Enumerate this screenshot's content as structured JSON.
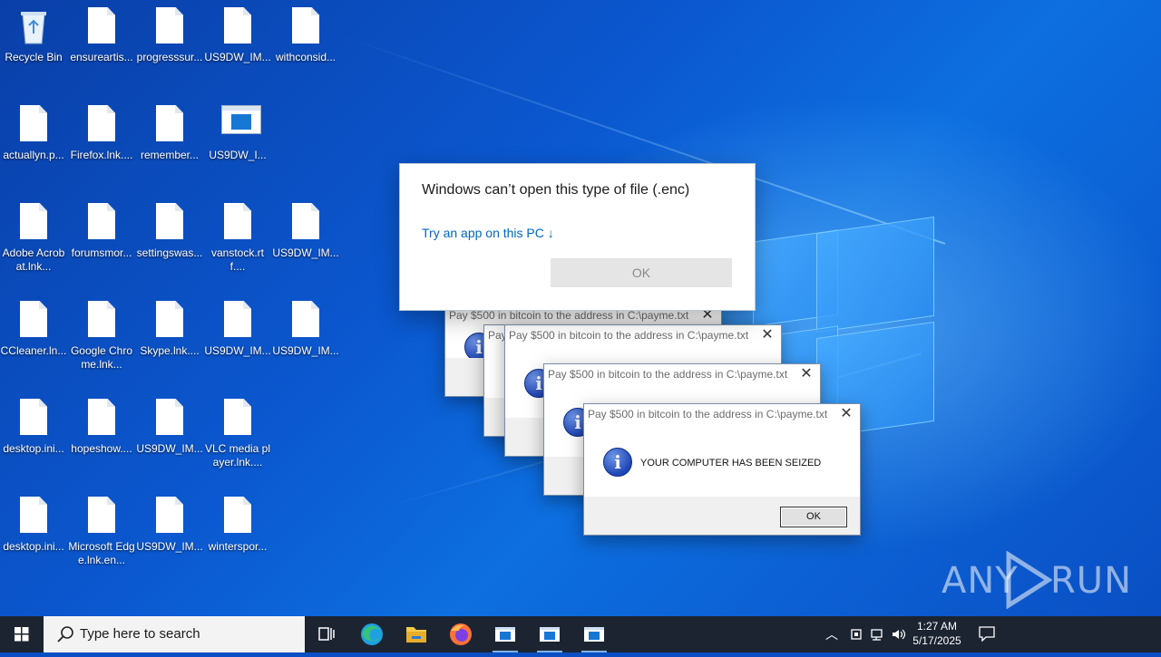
{
  "desktop": {
    "icons": [
      {
        "label": "Recycle Bin",
        "kind": "recycle-bin"
      },
      {
        "label": "ensureartis...",
        "kind": "file"
      },
      {
        "label": "progresssur...",
        "kind": "file"
      },
      {
        "label": "US9DW_IM...",
        "kind": "file"
      },
      {
        "label": "withconsid...",
        "kind": "file"
      },
      {
        "label": "actuallyn.p...",
        "kind": "file"
      },
      {
        "label": "Firefox.lnk....",
        "kind": "file"
      },
      {
        "label": "remember...",
        "kind": "file"
      },
      {
        "label": "US9DW_I...",
        "kind": "app-window"
      },
      {
        "label": "Adobe Acrobat.lnk...",
        "kind": "file"
      },
      {
        "label": "forumsmor...",
        "kind": "file"
      },
      {
        "label": "settingswas...",
        "kind": "file"
      },
      {
        "label": "vanstock.rtf....",
        "kind": "file"
      },
      {
        "label": "US9DW_IM...",
        "kind": "file"
      },
      {
        "label": "CCleaner.ln...",
        "kind": "file"
      },
      {
        "label": "Google Chrome.lnk...",
        "kind": "file"
      },
      {
        "label": "Skype.lnk....",
        "kind": "file"
      },
      {
        "label": "US9DW_IM...",
        "kind": "file"
      },
      {
        "label": "US9DW_IM...",
        "kind": "file"
      },
      {
        "label": "desktop.ini...",
        "kind": "file"
      },
      {
        "label": "hopeshow....",
        "kind": "file"
      },
      {
        "label": "US9DW_IM...",
        "kind": "file"
      },
      {
        "label": "VLC media player.lnk....",
        "kind": "file"
      },
      {
        "label": "desktop.ini...",
        "kind": "file"
      },
      {
        "label": "Microsoft Edge.lnk.en...",
        "kind": "file"
      },
      {
        "label": "US9DW_IM...",
        "kind": "file"
      },
      {
        "label": "winterspor...",
        "kind": "file"
      }
    ]
  },
  "openwith_dialog": {
    "heading": "Windows can’t open this type of file (.enc)",
    "link": "Try an app on this PC ↓",
    "ok_label": "OK"
  },
  "ransom_boxes": [
    {
      "title": "Pay $500 in bitcoin to the address in C:\\payme.txt",
      "close": "✕"
    },
    {
      "title": "Pay $500 in bitcoin to the address in C:\\payme.txt",
      "close": "✕"
    },
    {
      "title": "Pay $500 in bitcoin to the address in C:\\payme.txt",
      "close": "✕"
    },
    {
      "title": "Pay $500 in bitcoin to the address in C:\\payme.txt",
      "close": "✕",
      "message": "YOUR COMPUTER HAS BEEN SEIZED",
      "ok_label": "OK"
    }
  ],
  "watermark": {
    "left": "ANY",
    "right": "RUN"
  },
  "taskbar": {
    "search_placeholder": "Type here to search",
    "time": "1:27 AM",
    "date": "5/17/2025",
    "pinned": [
      "task-view",
      "edge",
      "file-explorer",
      "firefox",
      "app-window",
      "app-window",
      "app-window"
    ],
    "accent": "#1c2432"
  },
  "colors": {
    "link": "#0067c0",
    "desktop_blue": "#0b58d0"
  }
}
